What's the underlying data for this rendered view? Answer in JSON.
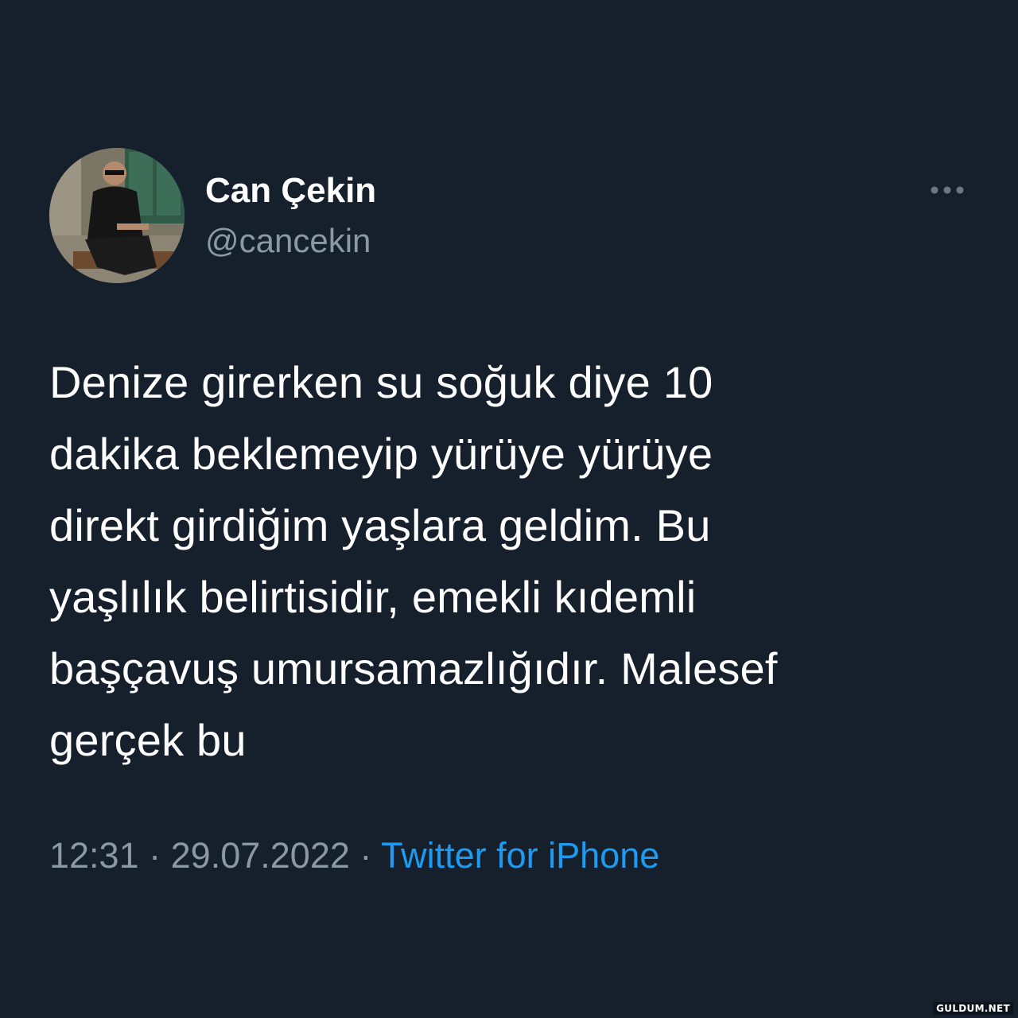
{
  "user": {
    "display_name": "Can Çekin",
    "handle": "@cancekin",
    "avatar_icon": "profile-photo"
  },
  "tweet": {
    "text_lines": [
      "Denize girerken su soğuk diye 10",
      "dakika beklemeyip yürüye yürüye",
      "direkt girdiğim yaşlara geldim. Bu",
      "yaşlılık belirtisidir, emekli kıdemli",
      "başçavuş umursamazlığıdır. Malesef",
      "gerçek bu"
    ]
  },
  "meta": {
    "time": "12:31",
    "separator": "·",
    "date": "29.07.2022",
    "source": "Twitter for iPhone"
  },
  "menu": {
    "icon": "more-horizontal-icon"
  },
  "watermark": "GULDUM.NET",
  "colors": {
    "background": "#16202c",
    "text": "#ffffff",
    "muted": "#8b98a5",
    "link": "#1d9bf0"
  }
}
